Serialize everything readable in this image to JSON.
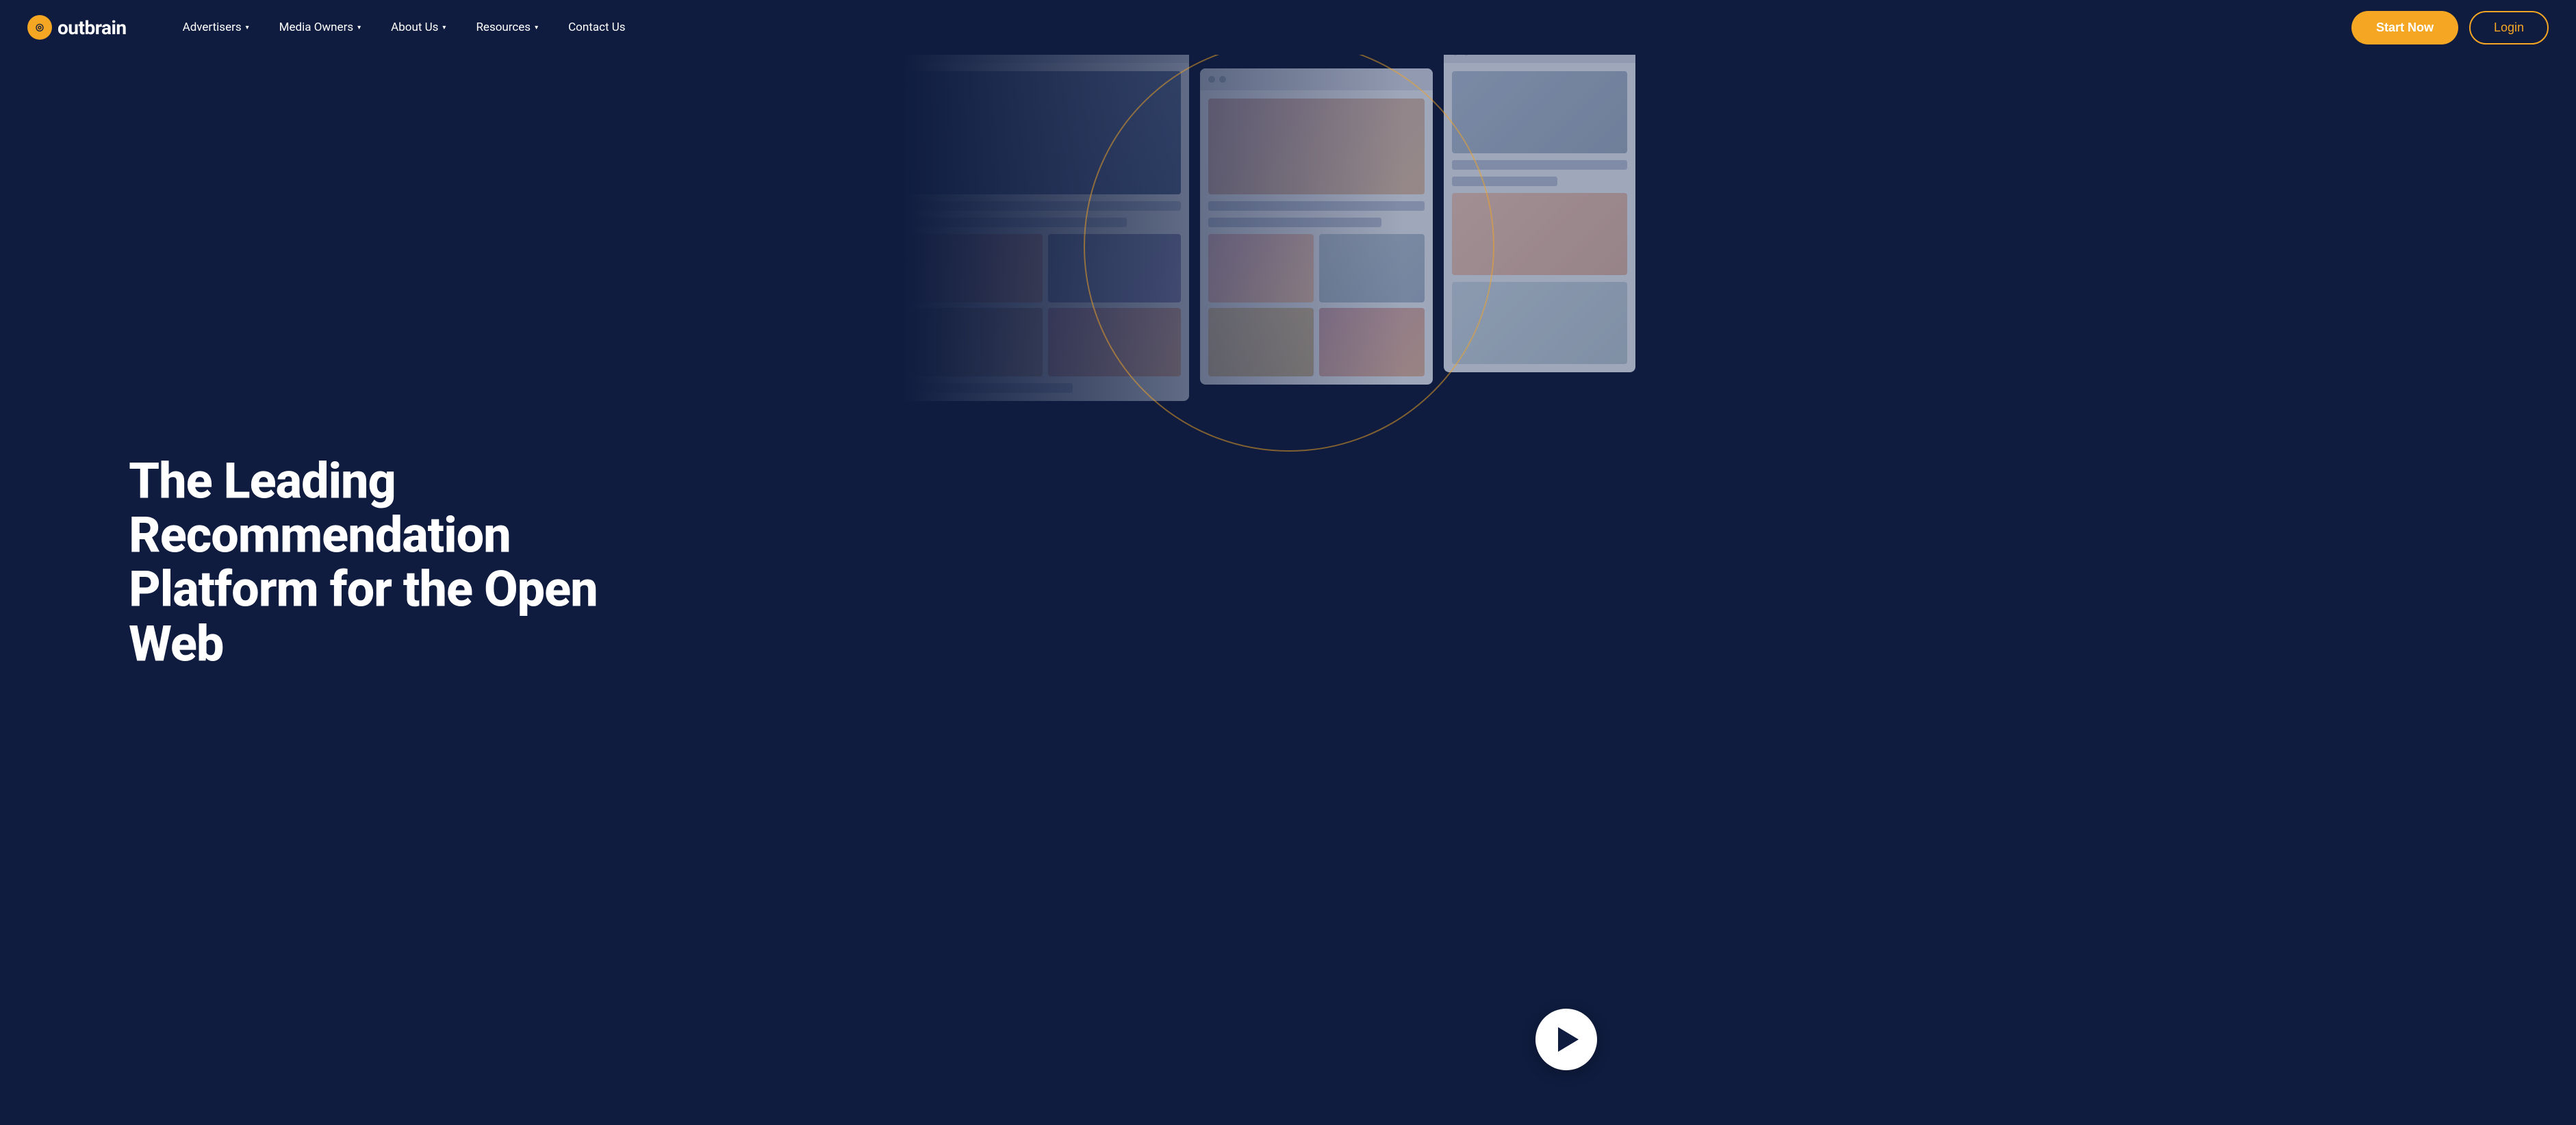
{
  "navbar": {
    "logo_text": "outbrain",
    "logo_icon": "◎",
    "nav_items": [
      {
        "label": "Advertisers",
        "has_dropdown": true
      },
      {
        "label": "Media Owners",
        "has_dropdown": true
      },
      {
        "label": "About Us",
        "has_dropdown": true
      },
      {
        "label": "Resources",
        "has_dropdown": true
      },
      {
        "label": "Contact Us",
        "has_dropdown": false
      }
    ],
    "start_now_label": "Start Now",
    "login_label": "Login"
  },
  "hero": {
    "heading": "The Leading Recommendation Platform for the Open Web",
    "play_button_label": "Play video"
  },
  "colors": {
    "brand_orange": "#f5a623",
    "brand_dark": "#0f1c3f"
  }
}
